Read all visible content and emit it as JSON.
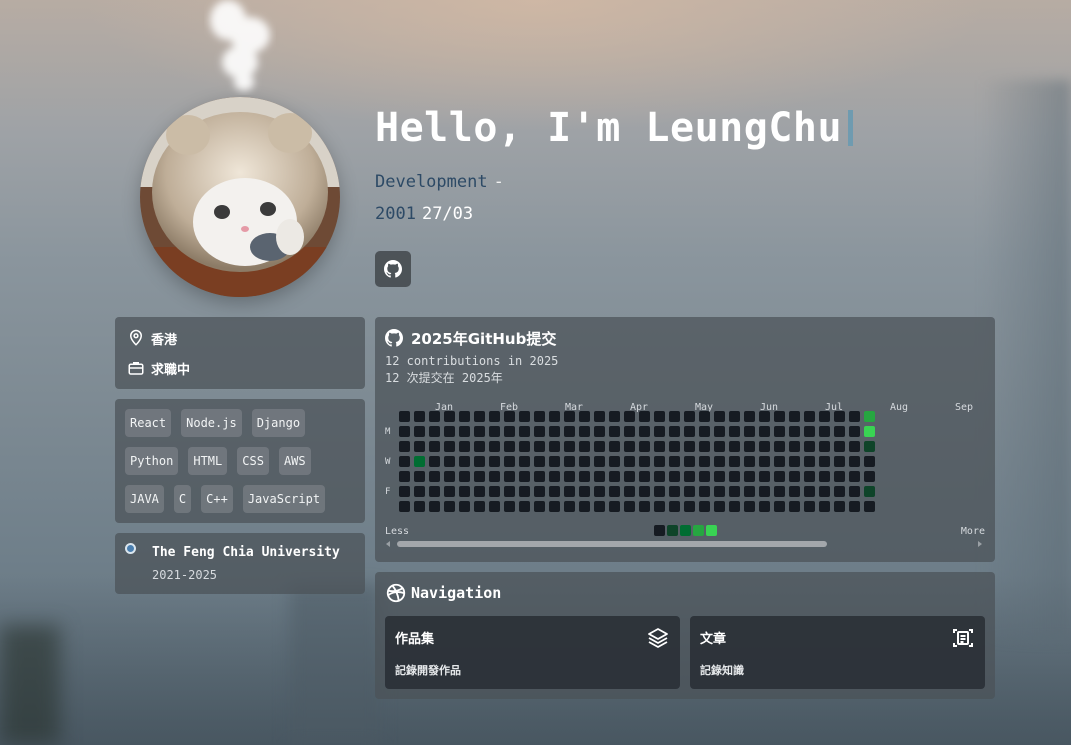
{
  "hero": {
    "title": "Hello, I'm LeungChu",
    "role": "Development",
    "role_sep": "-",
    "birth_year": "2001",
    "birth_day": "27/03"
  },
  "icons": {
    "github_button": "github-icon",
    "location": "map-pin-icon",
    "status": "briefcase-icon",
    "education": "timeline-dot-icon",
    "navigation": "dribbble-icon",
    "portfolio": "layers-icon",
    "articles": "document-scan-icon"
  },
  "info": {
    "location": "香港",
    "status": "求職中"
  },
  "skills": [
    "React",
    "Node.js",
    "Django",
    "Python",
    "HTML",
    "CSS",
    "AWS",
    "JAVA",
    "C",
    "C++",
    "JavaScript"
  ],
  "education": {
    "school": "The Feng Chia University",
    "years": "2021-2025"
  },
  "github": {
    "title": "2025年GitHub提交",
    "summary_en": "12 contributions in 2025",
    "summary_zh": "12 次提交在 2025年",
    "months": [
      "Jan",
      "Feb",
      "Mar",
      "Apr",
      "May",
      "Jun",
      "Jul",
      "Aug",
      "Sep"
    ],
    "day_labels": [
      "M",
      "W",
      "F"
    ],
    "legend_less": "Less",
    "legend_more": "More",
    "weeks_filled": 32,
    "current_week_days": 7,
    "contributions": [
      {
        "week": 1,
        "day": 3,
        "level": 2
      },
      {
        "week": 31,
        "day": 0,
        "level": 3
      },
      {
        "week": 31,
        "day": 1,
        "level": 4
      },
      {
        "week": 31,
        "day": 2,
        "level": 1
      },
      {
        "week": 31,
        "day": 5,
        "level": 1
      }
    ],
    "level_colors": [
      "#161b22",
      "#0e4429",
      "#006d32",
      "#26a641",
      "#39d353"
    ]
  },
  "navigation": {
    "title": "Navigation",
    "tiles": [
      {
        "title": "作品集",
        "desc": "記錄開發作品"
      },
      {
        "title": "文章",
        "desc": "記錄知識"
      }
    ]
  }
}
